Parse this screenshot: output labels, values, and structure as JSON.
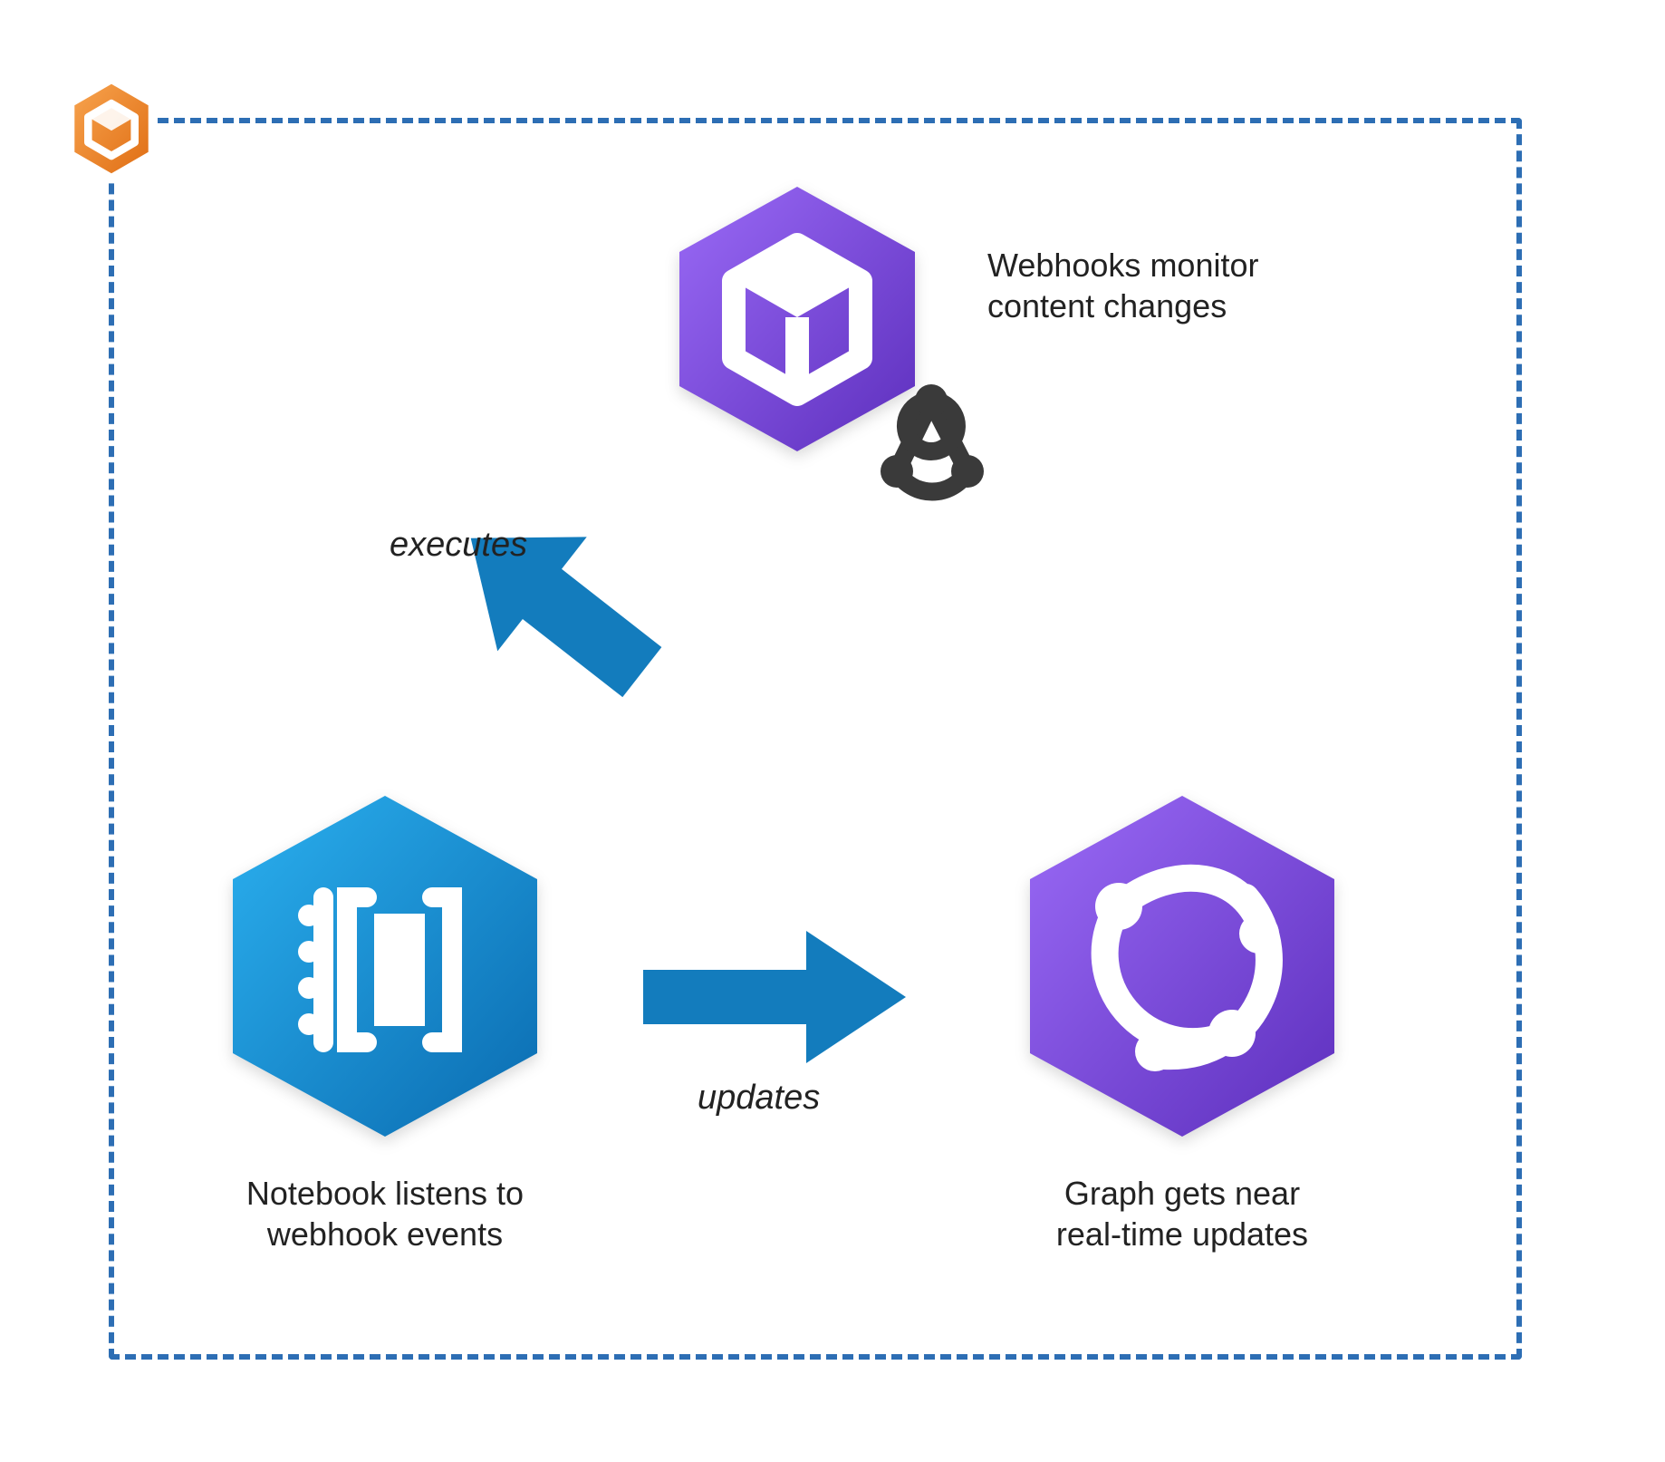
{
  "diagram": {
    "webhooks_caption_line1": "Webhooks monitor",
    "webhooks_caption_line2": "content changes",
    "notebook_caption_line1": "Notebook listens to",
    "notebook_caption_line2": "webhook events",
    "graph_caption_line1": "Graph gets near",
    "graph_caption_line2": "real-time updates",
    "arrow_executes_label": "executes",
    "arrow_updates_label": "updates"
  },
  "colors": {
    "border": "#2d6eb4",
    "arrow": "#137cbd",
    "purple_light": "#8a5cf0",
    "purple_dark": "#6233c8",
    "blue_light": "#1ea0e6",
    "blue_dark": "#0d72b9",
    "orange_light": "#f4933a",
    "orange_dark": "#e06e14",
    "webhook_gray": "#3a3a3a"
  }
}
